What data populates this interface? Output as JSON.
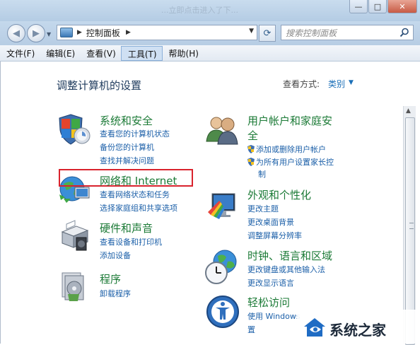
{
  "titlebar": {
    "faded_text": "...立即点击进入了下..."
  },
  "window_buttons": {
    "minimize": "—",
    "maximize": "□",
    "close": "✕"
  },
  "address_bar": {
    "crumb": "控制面板",
    "dropdown": "▼"
  },
  "search": {
    "placeholder": "搜索控制面板"
  },
  "menubar": [
    "文件(F)",
    "编辑(E)",
    "查看(V)",
    "工具(T)",
    "帮助(H)"
  ],
  "menubar_active_index": 3,
  "heading": "调整计算机的设置",
  "view_by": {
    "label": "查看方式:",
    "value": "类别"
  },
  "categories": [
    {
      "title": "系统和安全",
      "icon": "shield-icon",
      "links": [
        "查看您的计算机状态",
        "备份您的计算机",
        "查找并解决问题"
      ]
    },
    {
      "title": "网络和 Internet",
      "icon": "globe-network-icon",
      "links": [
        "查看网络状态和任务",
        "选择家庭组和共享选项"
      ],
      "highlighted": true
    },
    {
      "title": "硬件和声音",
      "icon": "printer-icon",
      "links": [
        "查看设备和打印机",
        "添加设备"
      ]
    },
    {
      "title": "程序",
      "icon": "programs-icon",
      "links": [
        "卸载程序"
      ]
    },
    {
      "title": "用户帐户和家庭安",
      "title_line2": "全",
      "icon": "users-icon",
      "links": [
        "添加或删除用户帐户",
        "为所有用户设置家长控",
        "制"
      ]
    },
    {
      "title": "外观和个性化",
      "icon": "appearance-icon",
      "links": [
        "更改主题",
        "更改桌面背景",
        "调整屏幕分辨率"
      ]
    },
    {
      "title": "时钟、语言和区域",
      "icon": "clock-globe-icon",
      "links": [
        "更改键盘或其他输入法",
        "更改显示语言"
      ]
    },
    {
      "title": "轻松访问",
      "icon": "ease-access-icon",
      "links": [
        "使用 Windows",
        "置"
      ]
    }
  ],
  "watermark": {
    "text": "系统之家"
  }
}
